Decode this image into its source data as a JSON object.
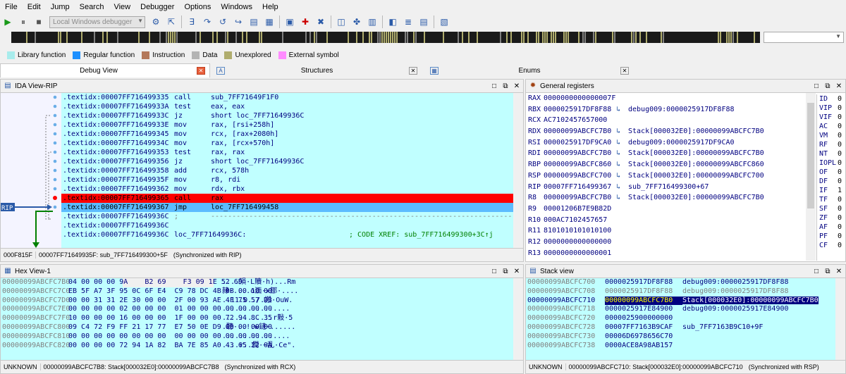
{
  "menu": [
    "File",
    "Edit",
    "Jump",
    "Search",
    "View",
    "Debugger",
    "Options",
    "Windows",
    "Help"
  ],
  "toolbar": {
    "debugger_name": "Local Windows debugger"
  },
  "legend": [
    {
      "label": "Library function",
      "color": "#a8ecec"
    },
    {
      "label": "Regular function",
      "color": "#1e90ff"
    },
    {
      "label": "Instruction",
      "color": "#b4785a"
    },
    {
      "label": "Data",
      "color": "#b4b4b4"
    },
    {
      "label": "Unexplored",
      "color": "#b0ad6e"
    },
    {
      "label": "External symbol",
      "color": "#ff8cff"
    }
  ],
  "tabs": [
    {
      "label": "Debug View",
      "icon": "",
      "active": true
    },
    {
      "label": "Structures",
      "icon": "A",
      "active": false
    },
    {
      "label": "Enums",
      "icon": "▦",
      "active": false
    }
  ],
  "ida": {
    "title": "IDA View-RIP",
    "rip_label": "RIP",
    "lines": [
      {
        "addr": ".textidx:00007FF716499335",
        "mn": "call",
        "op": "sub_7FF71649F1F0",
        "cls": ""
      },
      {
        "addr": ".textidx:00007FF71649933A",
        "mn": "test",
        "op": "eax, eax",
        "cls": ""
      },
      {
        "addr": ".textidx:00007FF71649933C",
        "mn": "jz",
        "op": "short loc_7FF71649936C",
        "cls": ""
      },
      {
        "addr": ".textidx:00007FF71649933E",
        "mn": "mov",
        "op": "rax, [rsi+258h]",
        "cls": ""
      },
      {
        "addr": ".textidx:00007FF716499345",
        "mn": "mov",
        "op": "rcx, [rax+2080h]",
        "cls": ""
      },
      {
        "addr": ".textidx:00007FF71649934C",
        "mn": "mov",
        "op": "rax, [rcx+570h]",
        "cls": ""
      },
      {
        "addr": ".textidx:00007FF716499353",
        "mn": "test",
        "op": "rax, rax",
        "cls": ""
      },
      {
        "addr": ".textidx:00007FF716499356",
        "mn": "jz",
        "op": "short loc_7FF71649936C",
        "cls": ""
      },
      {
        "addr": ".textidx:00007FF716499358",
        "mn": "add",
        "op": "rcx, 578h",
        "cls": ""
      },
      {
        "addr": ".textidx:00007FF71649935F",
        "mn": "mov",
        "op": "r8, rdi",
        "cls": ""
      },
      {
        "addr": ".textidx:00007FF716499362",
        "mn": "mov",
        "op": "rdx, rbx",
        "cls": ""
      },
      {
        "addr": ".textidx:00007FF716499365",
        "mn": "call",
        "op": "rax",
        "cls": "hl-red"
      },
      {
        "addr": ".textidx:00007FF716499367",
        "mn": "jmp",
        "op": "loc_7FF716499458",
        "cls": "hl-cur"
      },
      {
        "addr": ".textidx:00007FF71649936C",
        "mn": ";",
        "op": "-----------------------------------------------------------------------------------",
        "cls": ""
      },
      {
        "addr": ".textidx:00007FF71649936C",
        "mn": "",
        "op": "",
        "cls": ""
      },
      {
        "addr": ".textidx:00007FF71649936C",
        "mn": "loc_7FF71649936C:",
        "op": "",
        "cmt": "; CODE XREF: sub_7FF716499300+3C↑j",
        "cls": ""
      }
    ],
    "status_offset": "000F815F",
    "status_loc": "00007FF71649935F: sub_7FF716499300+5F",
    "status_sync": "(Synchronized with RIP)"
  },
  "regs": {
    "title": "General registers",
    "lines": [
      {
        "name": "RAX",
        "val": "0000000000000007F",
        "desc": ""
      },
      {
        "name": "RBX",
        "val": "0000025917DF8F88",
        "desc": "debug009:0000025917DF8F88"
      },
      {
        "name": "RCX",
        "val": "AC7102457657000",
        "desc": ""
      },
      {
        "name": "RDX",
        "val": "00000099ABCFC7B0",
        "desc": "Stack[000032E0]:00000099ABCFC7B0"
      },
      {
        "name": "RSI",
        "val": "0000025917DF9CA0",
        "desc": "debug009:0000025917DF9CA0"
      },
      {
        "name": "RDI",
        "val": "00000099ABCFC7B0",
        "desc": "Stack[000032E0]:00000099ABCFC7B0"
      },
      {
        "name": "RBP",
        "val": "00000099ABCFC860",
        "desc": "Stack[000032E0]:00000099ABCFC860"
      },
      {
        "name": "RSP",
        "val": "00000099ABCFC700",
        "desc": "Stack[000032E0]:00000099ABCFC700"
      },
      {
        "name": "RIP",
        "val": "00007FF716499367",
        "desc": "sub_7FF716499300+67"
      },
      {
        "name": "R8",
        "val": "00000099ABCFC7B0",
        "desc": "Stack[000032E0]:00000099ABCFC7B0"
      },
      {
        "name": "R9",
        "val": "00001206B7E9B82D",
        "desc": ""
      },
      {
        "name": "R10",
        "val": "000AC7102457657",
        "desc": ""
      },
      {
        "name": "R11",
        "val": "8101010101010100",
        "desc": ""
      },
      {
        "name": "R12",
        "val": "0000000000000000",
        "desc": ""
      },
      {
        "name": "R13",
        "val": "0000000000000001",
        "desc": ""
      }
    ],
    "flags": [
      {
        "n": "ID",
        "v": "0"
      },
      {
        "n": "VIP",
        "v": "0"
      },
      {
        "n": "VIF",
        "v": "0"
      },
      {
        "n": "AC",
        "v": "0"
      },
      {
        "n": "VM",
        "v": "0"
      },
      {
        "n": "RF",
        "v": "0"
      },
      {
        "n": "NT",
        "v": "0"
      },
      {
        "n": "IOPL",
        "v": "0"
      },
      {
        "n": "OF",
        "v": "0"
      },
      {
        "n": "DF",
        "v": "0"
      },
      {
        "n": "IF",
        "v": "1"
      },
      {
        "n": "TF",
        "v": "0"
      },
      {
        "n": "SF",
        "v": "0"
      },
      {
        "n": "ZF",
        "v": "0"
      },
      {
        "n": "AF",
        "v": "0"
      },
      {
        "n": "PF",
        "v": "0"
      },
      {
        "n": "CF",
        "v": "0"
      }
    ]
  },
  "hex": {
    "title": "Hex View-1",
    "lines": [
      {
        "addr": "00000099ABCFC7B0",
        "bytes": "04 00 00 00 9A    B2 69    F3 09 1E 52 6D",
        "ascii": "....殞·L贖·h)...Rm"
      },
      {
        "addr": "00000099ABCFC7C0",
        "bytes": "EB 5F A7 3F 95 0C 6F E4  C9 78 DC 4B 0B 00 10 00",
        "ascii": "隷·....o湎·x鄒·...."
      },
      {
        "addr": "00000099ABCFC7D0",
        "bytes": "00 00 31 31 2E 30 00 00  2F 00 93 AE 4F 75 57 D3",
        "ascii": "..11.0../.搬·OuW."
      },
      {
        "addr": "00000099ABCFC7E0",
        "bytes": "00 00 00 00 02 00 00 00  01 00 00 00 00 00 00 00",
        "ascii": "................"
      },
      {
        "addr": "00000099ABCFC7F0",
        "bytes": "10 00 00 00 16 00 00 00  1F 00 00 00 72 94 8C 35",
        "ascii": "............r敤·5"
      },
      {
        "addr": "00000099ABCFC800",
        "bytes": "09 C4 72 F9 FF 21 17 77  E7 50 0E D9 00 00 00 00",
        "ascii": ".聽·..!.w鏈·......"
      },
      {
        "addr": "00000099ABCFC810",
        "bytes": "00 00 00 00 00 00 00 00  00 00 00 00 00 00 00 00",
        "ascii": "................"
      },
      {
        "addr": "00000099ABCFC820",
        "bytes": "00 00 00 00 72 94 1A 82  BA 7E 85 A0 43 65 22 0A",
        "ascii": "....r..僴·~乱·Ce\"."
      }
    ],
    "status_mode": "UNKNOWN",
    "status_loc": "00000099ABCFC7B8: Stack[000032E0]:00000099ABCFC7B8",
    "status_sync": "(Synchronized with RCX)"
  },
  "stack": {
    "title": "Stack view",
    "lines": [
      {
        "addr": "00000099ABCFC700",
        "val": "0000025917DF8F88",
        "desc": "debug009:0000025917DF8F88",
        "cls": ""
      },
      {
        "addr": "00000099ABCFC708",
        "val": "0000025917DF8F88",
        "desc": "debug009:0000025917DF8F88",
        "cls": "dim"
      },
      {
        "addr": "00000099ABCFC710",
        "val": "00000099ABCFC7B0",
        "desc": "Stack[000032E0]:00000099ABCFC7B0",
        "cls": "cur"
      },
      {
        "addr": "00000099ABCFC718",
        "val": "0000025917E84900",
        "desc": "debug009:0000025917E84900",
        "cls": ""
      },
      {
        "addr": "00000099ABCFC720",
        "val": "0000025900000000",
        "desc": "",
        "cls": ""
      },
      {
        "addr": "00000099ABCFC728",
        "val": "00007FF7163B9CAF",
        "desc": "sub_7FF7163B9C10+9F",
        "cls": ""
      },
      {
        "addr": "00000099ABCFC730",
        "val": "00006D6978656C70",
        "desc": "",
        "cls": ""
      },
      {
        "addr": "00000099ABCFC738",
        "val": "0000ACE8A98AB157",
        "desc": "",
        "cls": ""
      }
    ],
    "status_mode": "UNKNOWN",
    "status_loc": "00000099ABCFC710: Stack[000032E0]:00000099ABCFC710",
    "status_sync": "(Synchronized with RSP)"
  }
}
